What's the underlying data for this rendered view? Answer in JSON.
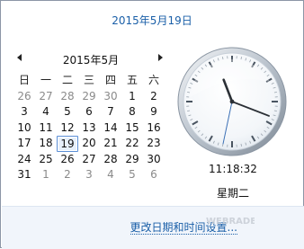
{
  "header": {
    "date_link": "2015年5月19日"
  },
  "calendar": {
    "month_title": "2015年5月",
    "weekdays": [
      "日",
      "一",
      "二",
      "三",
      "四",
      "五",
      "六"
    ],
    "weeks": [
      [
        "26",
        "27",
        "28",
        "29",
        "30",
        "1",
        "2"
      ],
      [
        "3",
        "4",
        "5",
        "6",
        "7",
        "8",
        "9"
      ],
      [
        "10",
        "11",
        "12",
        "13",
        "14",
        "15",
        "16"
      ],
      [
        "17",
        "18",
        "19",
        "20",
        "21",
        "22",
        "23"
      ],
      [
        "24",
        "25",
        "26",
        "27",
        "28",
        "29",
        "30"
      ],
      [
        "31",
        "1",
        "2",
        "3",
        "4",
        "5",
        "6"
      ]
    ],
    "other_month_cells": [
      "0-0",
      "0-1",
      "0-2",
      "0-3",
      "0-4",
      "5-1",
      "5-2",
      "5-3",
      "5-4",
      "5-5",
      "5-6"
    ],
    "today_cell": "3-2",
    "prev_icon": "triangle-left-icon",
    "next_icon": "triangle-right-icon"
  },
  "clock": {
    "hours": 11,
    "minutes": 18,
    "seconds": 32
  },
  "time_display": "11:18:32",
  "weekday_display": "星期二",
  "footer": {
    "link": "更改日期和时间设置..."
  },
  "watermark": {
    "text": "WEBRADE"
  },
  "colors": {
    "link": "#1a5fa8",
    "today_border": "#5b8fd6",
    "footer_bg": "#f1f5fb",
    "second_hand": "#3a6fb5"
  }
}
